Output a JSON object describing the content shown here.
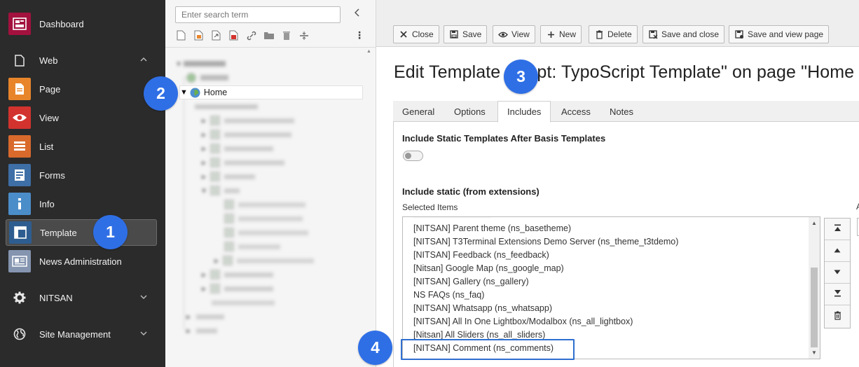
{
  "module_menu": {
    "items": [
      {
        "label": "Dashboard",
        "icon": "dashboard-icon",
        "color": "#a3113f"
      },
      {
        "label": "Web",
        "icon": "web-page-icon",
        "group": true,
        "expanded": true
      },
      {
        "label": "Page",
        "icon": "page-module-icon",
        "color": "#e8852b"
      },
      {
        "label": "View",
        "icon": "view-eye-icon",
        "color": "#d3332e"
      },
      {
        "label": "List",
        "icon": "list-icon",
        "color": "#d96a2c"
      },
      {
        "label": "Forms",
        "icon": "forms-icon",
        "color": "#3e6fa6"
      },
      {
        "label": "Info",
        "icon": "info-icon",
        "color": "#4b8dc9"
      },
      {
        "label": "Template",
        "icon": "template-icon",
        "color": "#2d5d90",
        "active": true
      },
      {
        "label": "News Administration",
        "icon": "news-icon",
        "color": "#8595b0"
      },
      {
        "label": "NITSAN",
        "icon": "gear-icon",
        "group": true,
        "expanded": false
      },
      {
        "label": "Site Management",
        "icon": "globe-icon",
        "group": true,
        "expanded": false
      }
    ]
  },
  "page_tree": {
    "search_placeholder": "Enter search term",
    "toolbar_icons": [
      "new-page-icon",
      "new-template-page-icon",
      "new-link-page-icon",
      "new-shortcut-page-icon",
      "link-icon",
      "folder-icon",
      "trash-icon",
      "divider-icon"
    ],
    "selected_node": "Home"
  },
  "docheader": {
    "buttons": [
      {
        "label": "Close",
        "icon": "close-icon"
      },
      {
        "label": "Save",
        "icon": "save-icon"
      },
      {
        "label": "View",
        "icon": "view-eye-icon"
      },
      {
        "label": "New",
        "icon": "plus-icon"
      },
      {
        "label": "Delete",
        "icon": "trash-icon"
      },
      {
        "label": "Save and close",
        "icon": "save-close-icon"
      },
      {
        "label": "Save and view page",
        "icon": "save-view-icon"
      }
    ]
  },
  "editor": {
    "title": "Edit Template \"...pt: TypoScript Template\" on page \"Home",
    "title_left": "Edit Template",
    "title_right": "pt: TypoScript Template\" on page \"Home",
    "tabs": [
      "General",
      "Options",
      "Includes",
      "Access",
      "Notes"
    ],
    "active_tab": "Includes",
    "include_after_label": "Include Static Templates After Basis Templates",
    "include_after_enabled": false,
    "include_static_label": "Include static (from extensions)",
    "selected_items_label": "Selected Items",
    "selected_items": [
      "[NITSAN] Parent theme (ns_basetheme)",
      "[NITSAN] T3Terminal Extensions Demo Server (ns_theme_t3tdemo)",
      "[NITSAN] Feedback (ns_feedback)",
      "[Nitsan] Google Map (ns_google_map)",
      "[NITSAN] Gallery (ns_gallery)",
      "NS FAQs (ns_faq)",
      "[NITSAN] Whatsapp (ns_whatsapp)",
      "[NITSAN] All In One Lightbox/Modalbox (ns_all_lightbox)",
      "[Nitsan] All Sliders (ns_all_sliders)",
      "[NITSAN] Comment (ns_comments)"
    ],
    "move_buttons": [
      "move-top-icon",
      "move-up-icon",
      "move-down-icon",
      "move-bottom-icon",
      "remove-trash-icon"
    ],
    "available_items_label_cut": "A"
  },
  "annotations": {
    "badges": [
      "1",
      "2",
      "3",
      "4"
    ],
    "badge_color": "#2f6fe6",
    "highlight_color": "#2f6fd0"
  }
}
